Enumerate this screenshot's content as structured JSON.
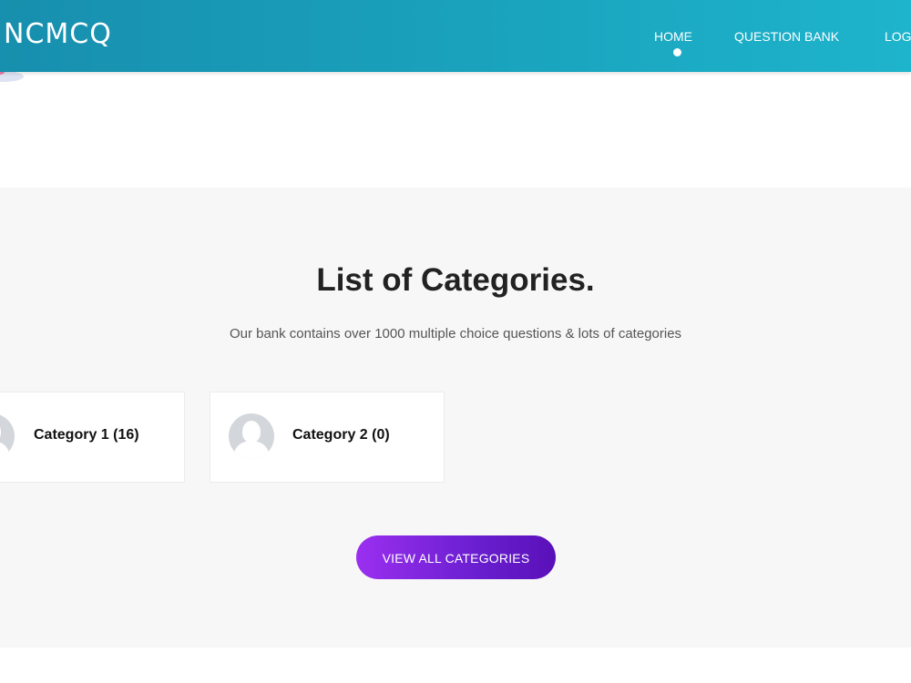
{
  "header": {
    "logo_text": "NCMCQ",
    "nav": [
      {
        "label": "HOME",
        "active": true
      },
      {
        "label": "QUESTION BANK",
        "active": false
      },
      {
        "label": "LOG"
      }
    ]
  },
  "section": {
    "title": "List of Categories.",
    "subtitle": "Our bank contains over 1000 multiple choice questions & lots of categories",
    "categories": [
      {
        "label": "Category 1 (16)",
        "icon": "user-avatar-icon"
      },
      {
        "label": "Category 2 (0)",
        "icon": "user-avatar-icon"
      }
    ],
    "button_label": "VIEW ALL CATEGORIES"
  },
  "colors": {
    "header_start": "#178fae",
    "header_end": "#1eb4cc",
    "button_start": "#9b2ff0",
    "button_end": "#5a10b8",
    "section_bg": "#f7f7f7"
  }
}
